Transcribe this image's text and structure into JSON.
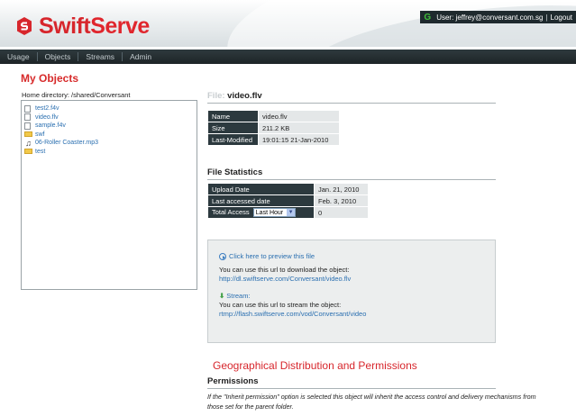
{
  "header": {
    "logo_part1": "Swift",
    "logo_part2": "Serve",
    "user_text": "User: jeffrey@conversant.com.sg",
    "separator": "|",
    "logout_label": "Logout"
  },
  "nav": {
    "items": [
      {
        "label": "Usage"
      },
      {
        "label": "Objects"
      },
      {
        "label": "Streams"
      },
      {
        "label": "Admin"
      }
    ]
  },
  "left": {
    "title": "My Objects",
    "home_directory": "Home directory: /shared/Conversant",
    "tree": [
      {
        "label": "test2.f4v",
        "icon": "file-icon"
      },
      {
        "label": "video.flv",
        "icon": "file-icon"
      },
      {
        "label": "sample.f4v",
        "icon": "file-icon"
      },
      {
        "label": "swf",
        "icon": "folder-icon"
      },
      {
        "label": "06-Roller Coaster.mp3",
        "icon": "music-icon"
      },
      {
        "label": "test",
        "icon": "folder-icon"
      }
    ]
  },
  "file": {
    "heading_label": "File:",
    "heading_name": "video.flv",
    "rows": [
      {
        "key": "Name",
        "value": "video.flv"
      },
      {
        "key": "Size",
        "value": "211.2 KB"
      },
      {
        "key": "Last-Modified",
        "value": "19:01:15 21-Jan-2010"
      }
    ]
  },
  "stats": {
    "heading": "File Statistics",
    "upload_date_label": "Upload Date",
    "upload_date_value": "Jan. 21, 2010",
    "last_accessed_label": "Last accessed date",
    "last_accessed_value": "Feb. 3, 2010",
    "total_access_label": "Total Access",
    "period_selected": "Last Hour",
    "total_access_value": "0"
  },
  "preview": {
    "preview_link": "Click here to preview this file",
    "download_text": "You can use this url to download the object:",
    "download_url": "http://dl.swiftserve.com/Conversant/video.flv",
    "stream_label": "Stream:",
    "stream_text": "You can use this url to stream the object:",
    "stream_url": "rtmp://flash.swiftserve.com/vod/Conversant/video"
  },
  "geo": {
    "heading": "Geographical Distribution and Permissions",
    "permissions_heading": "Permissions",
    "permissions_text": "If the \"Inherit permission\" option is selected this object will inherit the access control and delivery mechanisms from those set for the parent folder."
  },
  "colors": {
    "brand_red": "#d7262c",
    "nav_bg": "#1d2427",
    "table_key_bg": "#2c393e",
    "link_blue": "#2a6fb0"
  }
}
